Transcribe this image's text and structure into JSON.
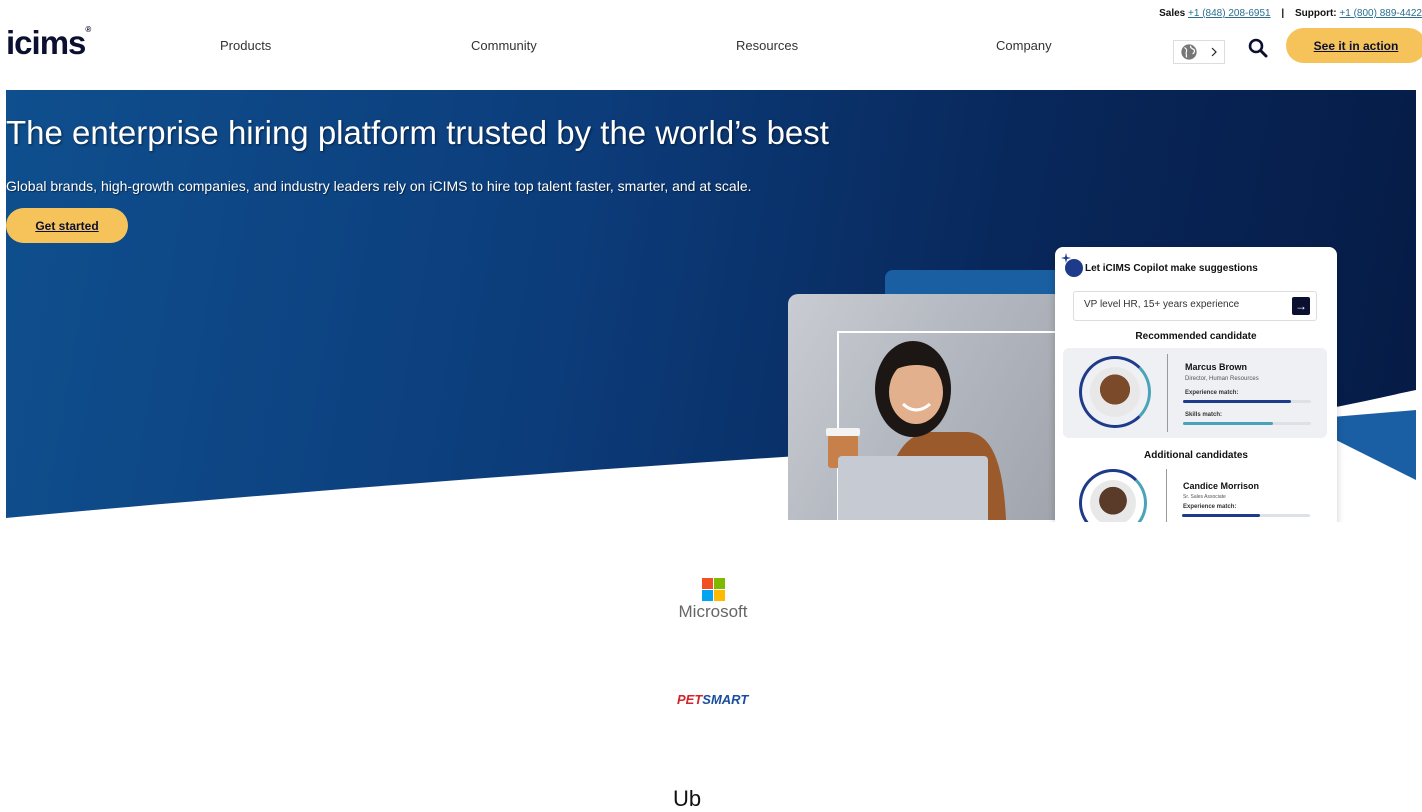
{
  "utility": {
    "sales_label": "Sales",
    "sales_phone": "+1 (848) 208-6951",
    "separator": "|",
    "support_label": "Support:",
    "support_phone": "+1 (800) 889-4422"
  },
  "header": {
    "logo_text": "icims",
    "nav": [
      "Products",
      "Community",
      "Resources",
      "Company"
    ],
    "cta_label": "See it in action"
  },
  "hero": {
    "title": "The enterprise hiring platform trusted by the world’s best",
    "subtitle": "Global brands, high-growth companies, and industry leaders rely on iCIMS to hire top talent faster, smarter, and at scale.",
    "cta_label": "Get started"
  },
  "copilot": {
    "heading": "Let iCIMS Copilot make suggestions",
    "query": "VP level HR, 15+ years experience",
    "recommended_heading": "Recommended candidate",
    "additional_heading": "Additional candidates",
    "candidates": [
      {
        "name": "Marcus Brown",
        "role": "Director, Human Resources",
        "experience_label": "Experience match:",
        "skills_label": "Skills match:",
        "experience": 0.84,
        "skills": 0.7
      },
      {
        "name": "Candice Morrison",
        "role": "Sr. Sales Associate",
        "experience_label": "Experience match:",
        "experience": 0.61
      }
    ]
  },
  "logos": {
    "microsoft": "Microsoft",
    "petsmart_a": "PET",
    "petsmart_b": "SMART",
    "next_heading_peek": "Ub"
  },
  "colors": {
    "accent": "#f5c35a",
    "navy": "#0b1030",
    "hero_start": "#0f4f8e",
    "hero_end": "#061b45"
  }
}
